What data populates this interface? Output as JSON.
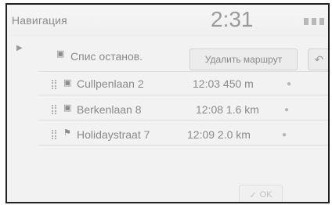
{
  "header": {
    "title": "Навигация",
    "clock": "2:31"
  },
  "route_header": {
    "list_label": "Спис останов.",
    "remove_button": "Удалить маршрут",
    "back_icon": "back-arrow-icon"
  },
  "stops": [
    {
      "name": "Cullpenlaan 2",
      "eta": "12:03 450 m",
      "icon": "waypoint-flag-icon"
    },
    {
      "name": "Berkenlaan 8",
      "eta": "12:08 1.6 km",
      "icon": "waypoint-flag-icon"
    },
    {
      "name": "Holidaystraat 7",
      "eta": "12:09 2.0 km",
      "icon": "destination-flag-icon"
    }
  ],
  "footer": {
    "ok_label": "OK"
  }
}
